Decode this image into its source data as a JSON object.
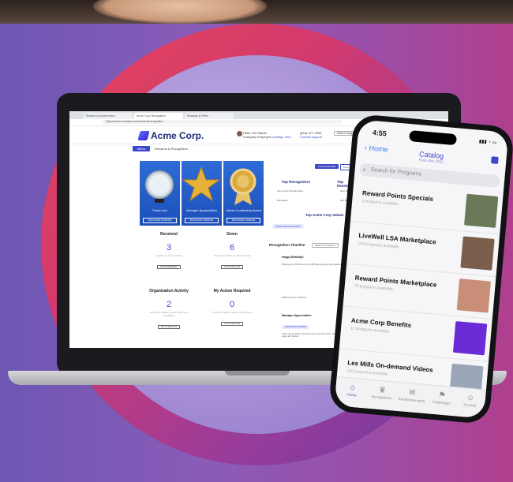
{
  "browser": {
    "tabs": [
      "Reward & Achievement",
      "Acme Corp Recognition",
      "Rewards & Perks"
    ],
    "url": "https://acme.example.com/rewards/recognition"
  },
  "app": {
    "brand": "Acme Corp.",
    "user_greeting": "Hello, Eric Bauer",
    "user_role": "Company Employee",
    "user_link": "(change role)",
    "phone": "(844) 377-7653",
    "support": "Contact support",
    "language": "Select Language",
    "menu_label": "Menu",
    "breadcrumb": "Rewards & Recognition",
    "points": "You Have 21,000 Points"
  },
  "cards": [
    {
      "label": "Thank you!",
      "button": "RECOGNIZE SOMEONE"
    },
    {
      "label": "Manager Appreciation",
      "button": "RECOGNIZE SOMEONE"
    },
    {
      "label": "Values Leadership Award",
      "button": "RECOGNIZE SOMEONE"
    }
  ],
  "stats": [
    {
      "title": "Received",
      "value": "3",
      "desc": "awards you have received",
      "button": "SHOW REWARDS"
    },
    {
      "title": "Given",
      "value": "6",
      "desc": "All types of awards you have provided",
      "button": "GO TO THE LIST"
    },
    {
      "title": "Organization Activity",
      "value": "2",
      "desc": "All types of awards provided within your organization",
      "button": "GO TO THE LIST"
    },
    {
      "title": "My Action Required",
      "value": "0",
      "desc": "All types of awards require your approval",
      "button": "GO TO THE LIST"
    }
  ],
  "right_panel": {
    "tabs": [
      "THIS QUARTER",
      "THIS MONTH"
    ],
    "top_recognizers_title": "Top Recognizers",
    "top_receivers_title": "Top Receivers",
    "recognizers": [
      "Acme Corp People Team",
      "Eric Bauer"
    ],
    "receivers": [
      "Alex Skator",
      "Eric Bauer"
    ],
    "values_title": "Top Acme Corp Values",
    "values_chip": "ADAPTABLE MINDSET",
    "timeline_title": "Recognition Timeline",
    "search_placeholder": "Search by recipient",
    "post1_title": "Happy Birthday!",
    "post1_text": "Wishing you all the best on your Birthday. Hope you had a great day!",
    "post1_cta": "2000 Instance in rendering",
    "post2_title": "Manager Appreciation",
    "post2_chip": "ADAPTABLE MINDSET",
    "post2_text": "Thank you for all the extra hours you put in this month. You went above and beyond"
  },
  "phone": {
    "time": "4:55",
    "back": "Home",
    "title": "Catalog",
    "subtitle": "Palo Alto (PA)",
    "search_placeholder": "Search for Programs",
    "items": [
      {
        "name": "Reward Points Specials",
        "count": "3 programs available",
        "thumb_color": "#6a7a59"
      },
      {
        "name": "LiveWell LSA Marketplace",
        "count": "169 programs available",
        "thumb_color": "#7a5f4d"
      },
      {
        "name": "Reward Points Marketplace",
        "count": "76 programs available",
        "thumb_color": "#c98e78"
      },
      {
        "name": "Acme Corp Benefits",
        "count": "12 programs available",
        "thumb_color": "#6b2bd6"
      },
      {
        "name": "Les Mills On-demand Videos",
        "count": "100 programs available",
        "thumb_color": "#9aa6b8"
      }
    ],
    "tabbar": [
      {
        "label": "Home",
        "icon": "home-icon",
        "glyph": "⌂"
      },
      {
        "label": "Recognitions",
        "icon": "trophy-icon",
        "glyph": "♛"
      },
      {
        "label": "Reimbursements",
        "icon": "money-icon",
        "glyph": "✉"
      },
      {
        "label": "Challenges",
        "icon": "figure-icon",
        "glyph": "⚑"
      },
      {
        "label": "Account",
        "icon": "user-icon",
        "glyph": "☺"
      }
    ]
  }
}
